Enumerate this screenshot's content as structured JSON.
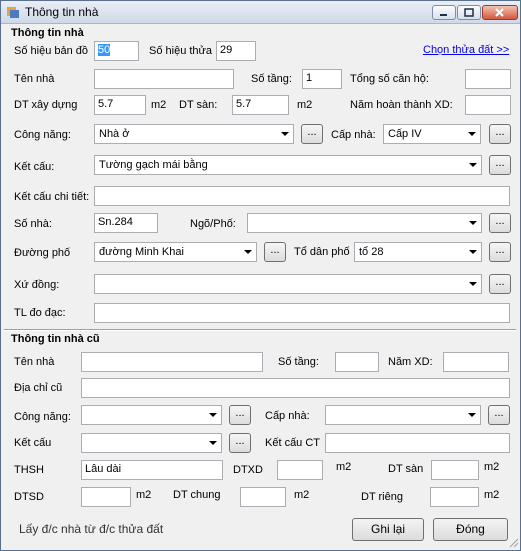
{
  "window": {
    "title": "Thông tin nhà"
  },
  "house": {
    "heading": "Thông tin nhà",
    "map_sheet_label": "Số hiệu bản đồ",
    "map_sheet_value": "50",
    "parcel_label": "Số hiệu thửa",
    "parcel_value": "29",
    "choose_parcel_link": "Chọn thửa đất  >>",
    "name_label": "Tên nhà",
    "name_value": "",
    "floors_label": "Số tầng:",
    "floors_value": "1",
    "apartments_label": "Tổng số căn hộ:",
    "apartments_value": "",
    "built_area_label": "DT xây dựng",
    "built_area_value": "5.7",
    "built_area_unit": "m2",
    "floor_area_label": "DT sàn:",
    "floor_area_value": "5.7",
    "floor_area_unit": "m2",
    "completed_year_label": "Năm hoàn thành XD:",
    "completed_year_value": "",
    "function_label": "Công năng:",
    "function_value": "Nhà ở",
    "grade_label": "Cấp nhà:",
    "grade_value": "Cấp IV",
    "structure_label": "Kết cấu:",
    "structure_value": "Tường gạch mái bằng",
    "structure_detail_label": "Kết cấu chi tiết:",
    "structure_detail_value": "",
    "house_number_label": "Số nhà:",
    "house_number_value": "Sn.284",
    "alley_label": "Ngõ/Phố:",
    "alley_value": "",
    "street_label": "Đường phố",
    "street_value": "đường Minh Khai",
    "residential_group_label": "Tổ dân phố",
    "residential_group_value": "tổ 28",
    "ward_label": "Xứ đồng:",
    "ward_value": "",
    "survey_label": "TL đo đạc:",
    "survey_value": "",
    "ellipsis": "..."
  },
  "old_house": {
    "heading": "Thông tin nhà cũ",
    "name_label": "Tên nhà",
    "name_value": "",
    "floors_label": "Số tầng:",
    "floors_value": "",
    "year_label": "Năm XD:",
    "year_value": "",
    "address_label": "Địa chỉ cũ",
    "address_value": "",
    "function_label": "Công năng:",
    "function_value": "",
    "grade_label": "Cấp nhà:",
    "grade_value": "",
    "structure_label": "Kết cấu",
    "structure_value": "",
    "structure_ct_label": "Kết cấu CT",
    "structure_ct_value": "",
    "thsh_label": "THSH",
    "thsh_value": "Lâu dài",
    "dtxd_label": "DTXD",
    "dtxd_value": "",
    "dtxd_unit": "m2",
    "dt_san_label": "DT sàn",
    "dt_san_value": "",
    "dt_san_unit": "m2",
    "dtsd_label": "DTSD",
    "dtsd_value": "",
    "dtsd_unit": "m2",
    "dt_chung_label": "DT chung",
    "dt_chung_value": "",
    "dt_chung_unit": "m2",
    "dt_rieng_label": "DT riêng",
    "dt_rieng_value": "",
    "dt_rieng_unit": "m2"
  },
  "footer": {
    "status": "Lấy đ/c nhà từ đ/c thửa đất",
    "save_label": "Ghi lại",
    "close_label": "Đóng"
  }
}
